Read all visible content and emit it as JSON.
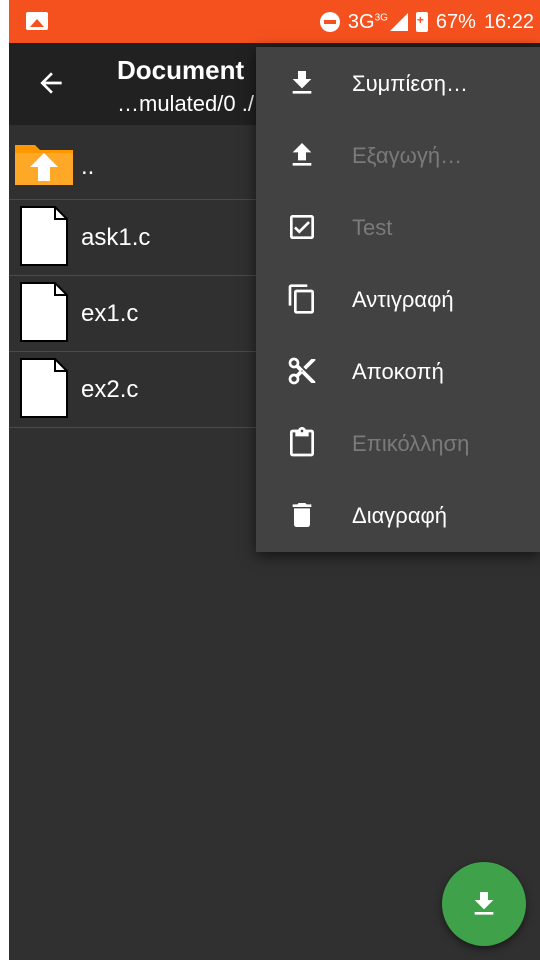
{
  "status_bar": {
    "network": "3G",
    "network_sup": "3G",
    "battery": "67%",
    "time": "16:22",
    "icons": [
      "gallery-notification-icon",
      "do-not-disturb-icon",
      "signal-icon",
      "battery-charging-icon"
    ]
  },
  "app_bar": {
    "title": "Document",
    "subtitle": "…mulated/0 ./"
  },
  "files": [
    {
      "name": "..",
      "icon": "parent-folder-icon"
    },
    {
      "name": "ask1.c",
      "icon": "file-icon"
    },
    {
      "name": "ex1.c",
      "icon": "file-icon"
    },
    {
      "name": "ex2.c",
      "icon": "file-icon"
    }
  ],
  "menu": {
    "items": [
      {
        "label": "Συμπίεση…",
        "icon": "download-icon",
        "enabled": true
      },
      {
        "label": "Εξαγωγή…",
        "icon": "upload-icon",
        "enabled": false
      },
      {
        "label": "Test",
        "icon": "checkbox-icon",
        "enabled": false
      },
      {
        "label": "Αντιγραφή",
        "icon": "copy-icon",
        "enabled": true
      },
      {
        "label": "Αποκοπή",
        "icon": "scissors-icon",
        "enabled": true
      },
      {
        "label": "Επικόλληση",
        "icon": "clipboard-icon",
        "enabled": false
      },
      {
        "label": "Διαγραφή",
        "icon": "trash-icon",
        "enabled": true
      }
    ]
  },
  "fab": {
    "icon": "download-icon"
  },
  "colors": {
    "status_bar": "#f4511e",
    "app_bar": "#212121",
    "background": "#303030",
    "menu": "#424242",
    "fab": "#3fa14a",
    "folder": "#ff9800"
  }
}
